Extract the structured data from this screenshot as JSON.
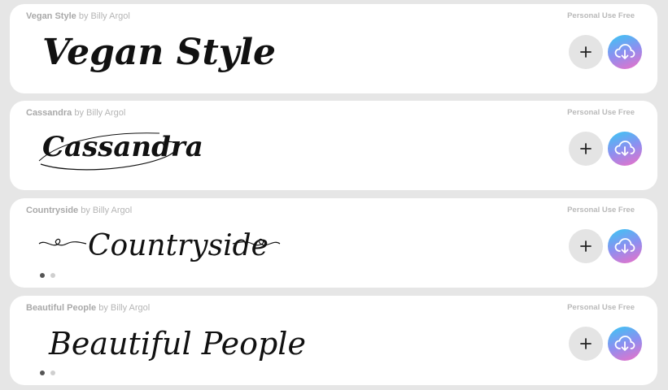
{
  "fonts": [
    {
      "name": "Vegan Style",
      "author_text": "by Billy Argol",
      "license": "Personal Use Free",
      "preview_text": "Vegan Style",
      "preview_ornament": "none",
      "dot_count": 0
    },
    {
      "name": "Cassandra",
      "author_text": "by Billy Argol",
      "license": "Personal Use Free",
      "preview_text": "Cassandra",
      "preview_ornament": "swash-oval",
      "dot_count": 0
    },
    {
      "name": "Countryside",
      "author_text": "by Billy Argol",
      "license": "Personal Use Free",
      "preview_text": "Countryside",
      "preview_ornament": "heart-swirls",
      "dot_count": 2
    },
    {
      "name": "Beautiful People",
      "author_text": "by Billy Argol",
      "license": "Personal Use Free",
      "preview_text": "Beautiful People",
      "preview_ornament": "none",
      "dot_count": 2
    }
  ],
  "icons": {
    "add": "plus-icon",
    "download": "cloud-download-icon"
  },
  "colors": {
    "page_background": "#e6e6e6",
    "card_background": "#ffffff",
    "meta_text": "#b5b5b5",
    "add_button": "#e4e4e4",
    "download_gradient_start": "#38c8f4",
    "download_gradient_mid": "#8d8ff0",
    "download_gradient_end": "#ee6fc6",
    "active_dot": "#555555",
    "inactive_dot": "#cfcfcf"
  }
}
